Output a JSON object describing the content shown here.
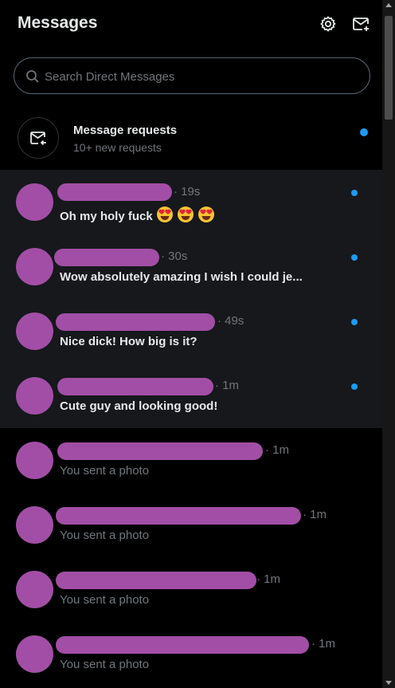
{
  "header": {
    "title": "Messages",
    "icons": [
      "settings-icon",
      "new-message-icon"
    ]
  },
  "search": {
    "placeholder": "Search Direct Messages"
  },
  "requests": {
    "title": "Message requests",
    "subtitle": "10+ new requests"
  },
  "conversations": [
    {
      "time": "· 19s",
      "preview": "Oh my holy fuck",
      "emoji": 3,
      "unread": true,
      "name_redacted": true
    },
    {
      "time": "· 30s",
      "preview": "Wow absolutely amazing I wish I could je...",
      "unread": true,
      "name_redacted": true
    },
    {
      "time": "· 49s",
      "preview": "Nice dick! How big is it?",
      "unread": true,
      "name_redacted": true
    },
    {
      "time": "· 1m",
      "preview": "Cute guy and looking good!",
      "unread": true,
      "name_redacted": true
    },
    {
      "time": "· 1m",
      "preview": "You sent a photo",
      "unread": false,
      "name_redacted": true
    },
    {
      "time": "· 1m",
      "preview": "You sent a photo",
      "unread": false,
      "name_redacted": true
    },
    {
      "time": "· 1m",
      "preview": "You sent a photo",
      "unread": false,
      "name_redacted": true
    },
    {
      "time": "· 1m",
      "preview": "You sent a photo",
      "unread": false,
      "name_redacted": true
    }
  ],
  "colors": {
    "background": "#000000",
    "unread_row": "#16181c",
    "accent": "#1d9bf0",
    "redaction": "#a24ea6",
    "muted_text": "#71767b"
  }
}
